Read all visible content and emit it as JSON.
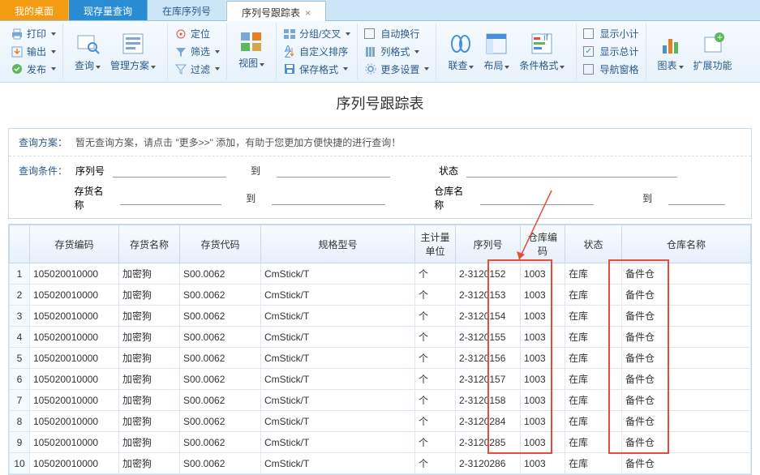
{
  "tabs": {
    "t1": "我的桌面",
    "t2": "现存量查询",
    "t3": "在库序列号",
    "t4": "序列号跟踪表",
    "close": "×"
  },
  "ribbon": {
    "print": "打印",
    "export": "输出",
    "publish": "发布",
    "query": "查询",
    "plan": "管理方案",
    "locate": "定位",
    "filter": "筛选",
    "filterClear": "过滤",
    "view": "视图",
    "group": "分组/交叉",
    "sort": "自定义排序",
    "saveFmt": "保存格式",
    "autoWrap": "自动换行",
    "colFmt": "列格式",
    "moreSet": "更多设置",
    "link": "联查",
    "layout": "布局",
    "condFmt": "条件格式",
    "subtotal": "显示小计",
    "total": "显示总计",
    "navPane": "导航窗格",
    "chart": "图表",
    "ext": "扩展功能"
  },
  "title": "序列号跟踪表",
  "query": {
    "planLabel": "查询方案：",
    "planText": "暂无查询方案，请点击 \"更多>>\" 添加，有助于您更加方便快捷的进行查询！",
    "condLabel": "查询条件：",
    "serial": "序列号",
    "to": "到",
    "status": "状态",
    "stockName": "存货名称",
    "whName": "仓库名称"
  },
  "cols": {
    "c1": "存货编码",
    "c2": "存货名称",
    "c3": "存货代码",
    "c4": "规格型号",
    "c5": "主计量单位",
    "c6": "序列号",
    "c7": "仓库编码",
    "c8": "状态",
    "c9": "仓库名称"
  },
  "rows": [
    {
      "n": "1",
      "code": "105020010000",
      "name": "加密狗",
      "scode": "S00.0062",
      "spec": "CmStick/T",
      "unit": "个",
      "serial": "2-3120152",
      "wh": "1003",
      "status": "在库",
      "whn": "备件仓"
    },
    {
      "n": "2",
      "code": "105020010000",
      "name": "加密狗",
      "scode": "S00.0062",
      "spec": "CmStick/T",
      "unit": "个",
      "serial": "2-3120153",
      "wh": "1003",
      "status": "在库",
      "whn": "备件仓"
    },
    {
      "n": "3",
      "code": "105020010000",
      "name": "加密狗",
      "scode": "S00.0062",
      "spec": "CmStick/T",
      "unit": "个",
      "serial": "2-3120154",
      "wh": "1003",
      "status": "在库",
      "whn": "备件仓"
    },
    {
      "n": "4",
      "code": "105020010000",
      "name": "加密狗",
      "scode": "S00.0062",
      "spec": "CmStick/T",
      "unit": "个",
      "serial": "2-3120155",
      "wh": "1003",
      "status": "在库",
      "whn": "备件仓"
    },
    {
      "n": "5",
      "code": "105020010000",
      "name": "加密狗",
      "scode": "S00.0062",
      "spec": "CmStick/T",
      "unit": "个",
      "serial": "2-3120156",
      "wh": "1003",
      "status": "在库",
      "whn": "备件仓"
    },
    {
      "n": "6",
      "code": "105020010000",
      "name": "加密狗",
      "scode": "S00.0062",
      "spec": "CmStick/T",
      "unit": "个",
      "serial": "2-3120157",
      "wh": "1003",
      "status": "在库",
      "whn": "备件仓"
    },
    {
      "n": "7",
      "code": "105020010000",
      "name": "加密狗",
      "scode": "S00.0062",
      "spec": "CmStick/T",
      "unit": "个",
      "serial": "2-3120158",
      "wh": "1003",
      "status": "在库",
      "whn": "备件仓"
    },
    {
      "n": "8",
      "code": "105020010000",
      "name": "加密狗",
      "scode": "S00.0062",
      "spec": "CmStick/T",
      "unit": "个",
      "serial": "2-3120284",
      "wh": "1003",
      "status": "在库",
      "whn": "备件仓"
    },
    {
      "n": "9",
      "code": "105020010000",
      "name": "加密狗",
      "scode": "S00.0062",
      "spec": "CmStick/T",
      "unit": "个",
      "serial": "2-3120285",
      "wh": "1003",
      "status": "在库",
      "whn": "备件仓"
    },
    {
      "n": "10",
      "code": "105020010000",
      "name": "加密狗",
      "scode": "S00.0062",
      "spec": "CmStick/T",
      "unit": "个",
      "serial": "2-3120286",
      "wh": "1003",
      "status": "在库",
      "whn": "备件仓"
    }
  ]
}
